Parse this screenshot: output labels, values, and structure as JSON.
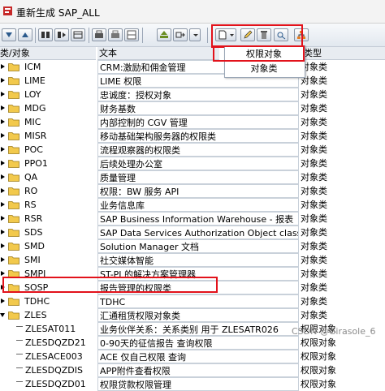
{
  "window": {
    "title": "重新生成 SAP_ALL"
  },
  "header": {
    "col1": "类/对象",
    "col2": "文本",
    "col3": "类型"
  },
  "dropdown": {
    "items": [
      "权限对象",
      "对象类"
    ]
  },
  "rows": [
    {
      "name": "ICM",
      "text": "CRM:激励和佣金管理",
      "type": "对象类"
    },
    {
      "name": "LIME",
      "text": "LIME 权限",
      "type": "对象类"
    },
    {
      "name": "LOY",
      "text": "忠诚度：授权对象",
      "type": "对象类"
    },
    {
      "name": "MDG",
      "text": "财务基数",
      "type": "对象类"
    },
    {
      "name": "MIC",
      "text": "内部控制的 CGV 管理",
      "type": "对象类"
    },
    {
      "name": "MISR",
      "text": "移动基础架构服务器的权限类",
      "type": "对象类"
    },
    {
      "name": "POC",
      "text": "流程观察器的权限类",
      "type": "对象类"
    },
    {
      "name": "PPO1",
      "text": "后续处理办公室",
      "type": "对象类"
    },
    {
      "name": "QA",
      "text": "质量管理",
      "type": "对象类"
    },
    {
      "name": "RO",
      "text": "权限：BW 服务 API",
      "type": "对象类"
    },
    {
      "name": "RS",
      "text": "业务信息库",
      "type": "对象类"
    },
    {
      "name": "RSR",
      "text": "SAP Business Information Warehouse - 报表",
      "type": "对象类"
    },
    {
      "name": "SDS",
      "text": "SAP Data Services Authorization Object class",
      "type": "对象类"
    },
    {
      "name": "SMD",
      "text": "Solution Manager 文档",
      "type": "对象类"
    },
    {
      "name": "SMI",
      "text": "社交媒体智能",
      "type": "对象类"
    },
    {
      "name": "SMPI",
      "text": "ST-PI 的解决方案管理器",
      "type": "对象类"
    },
    {
      "name": "SOSP",
      "text": "报告管理的权限类",
      "type": "对象类"
    },
    {
      "name": "TDHC",
      "text": "TDHC",
      "type": "对象类"
    },
    {
      "name": "ZLES",
      "text": "汇通租赁权限对象类",
      "type": "对象类"
    },
    {
      "name": "ZLESAT011",
      "text": "业务伙伴关系：关系类别 用于 ZLESATR026",
      "type": "权限对象"
    },
    {
      "name": "ZLESDQZD21",
      "text": "0-90天的征信报告 查询权限",
      "type": "权限对象"
    },
    {
      "name": "ZLESACE003",
      "text": "ACE 仅自己权限 查询",
      "type": "权限对象"
    },
    {
      "name": "ZLESDQZDIS",
      "text": "APP附件查看权限",
      "type": "权限对象"
    },
    {
      "name": "ZLESDQZD01",
      "text": "权限贷款权限管理",
      "type": "权限对象"
    }
  ],
  "watermark": "CSDN @Girasole_6",
  "colors": {
    "highlight": "#e2121b",
    "folder": "#f2c94c",
    "header_bg": "#e8ecf1"
  }
}
